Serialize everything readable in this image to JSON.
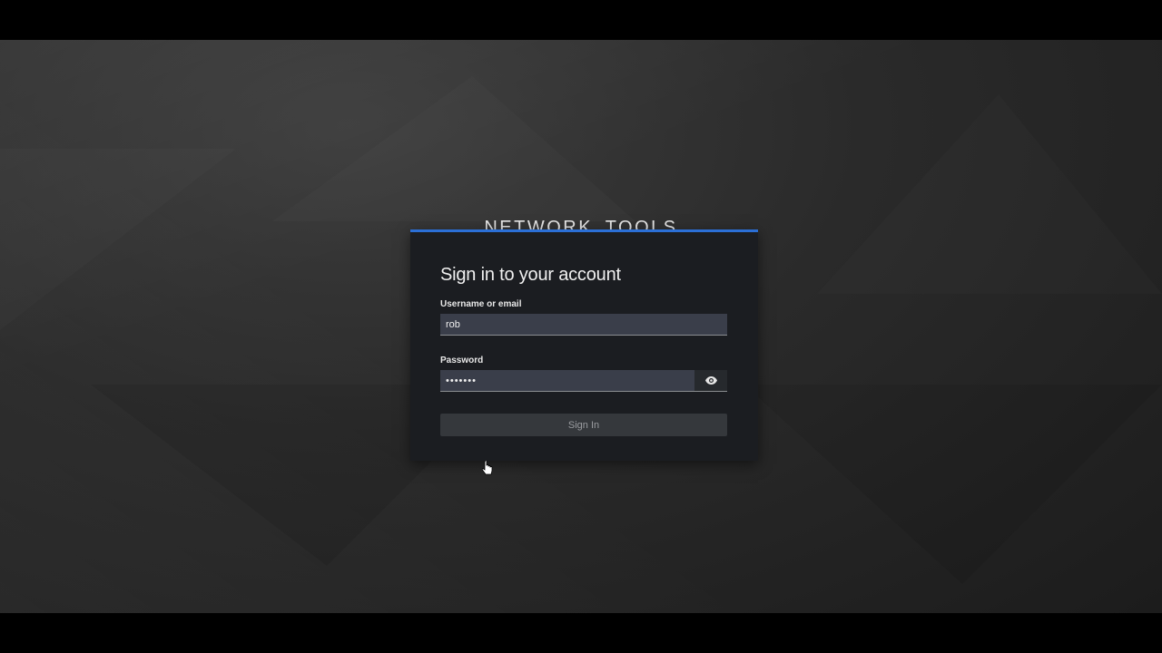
{
  "brand": {
    "title": "NETWORK_TOOLS"
  },
  "login": {
    "heading": "Sign in to your account",
    "username_label": "Username or email",
    "username_value": "rob",
    "password_label": "Password",
    "password_value": "•••••••",
    "show_password_icon": "eye-icon",
    "submit_label": "Sign In"
  },
  "colors": {
    "accent": "#2b6fd6",
    "card_bg": "#1b1d21",
    "input_bg": "#3a3e4a",
    "button_bg": "#35383c"
  }
}
